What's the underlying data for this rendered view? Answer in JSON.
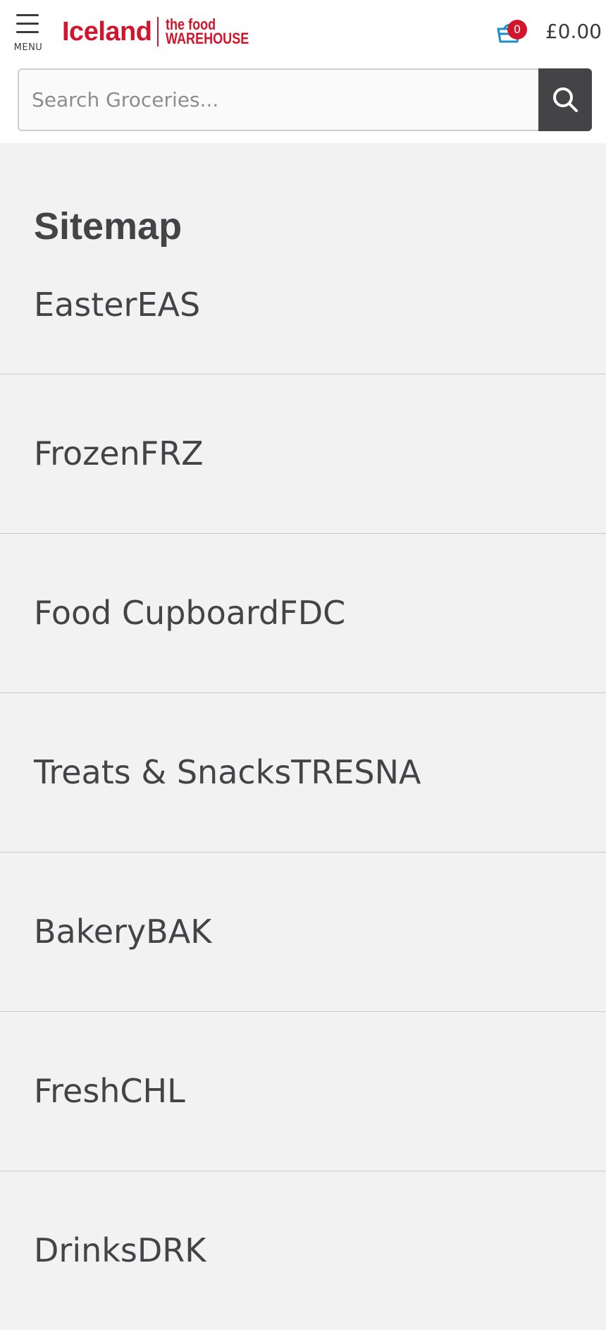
{
  "header": {
    "menu_label": "MENU",
    "logo": {
      "brand": "Iceland",
      "sub_line1": "the food",
      "sub_line2": "WAREHOUSE"
    },
    "basket": {
      "count": "0",
      "total": "£0.00"
    },
    "search": {
      "placeholder": "Search Groceries..."
    }
  },
  "colors": {
    "brand_red": "#d2152c",
    "basket_blue": "#1a8fc9",
    "text_dark": "#444447",
    "page_bg": "#f2f2f2"
  },
  "icons": {
    "menu": "hamburger-icon",
    "basket": "basket-icon",
    "search": "search-icon"
  },
  "page": {
    "title": "Sitemap",
    "items": [
      {
        "label": "EasterEAS"
      },
      {
        "label": "FrozenFRZ"
      },
      {
        "label": "Food CupboardFDC"
      },
      {
        "label": "Treats & SnacksTRESNA"
      },
      {
        "label": "BakeryBAK"
      },
      {
        "label": "FreshCHL"
      },
      {
        "label": "DrinksDRK"
      }
    ]
  }
}
